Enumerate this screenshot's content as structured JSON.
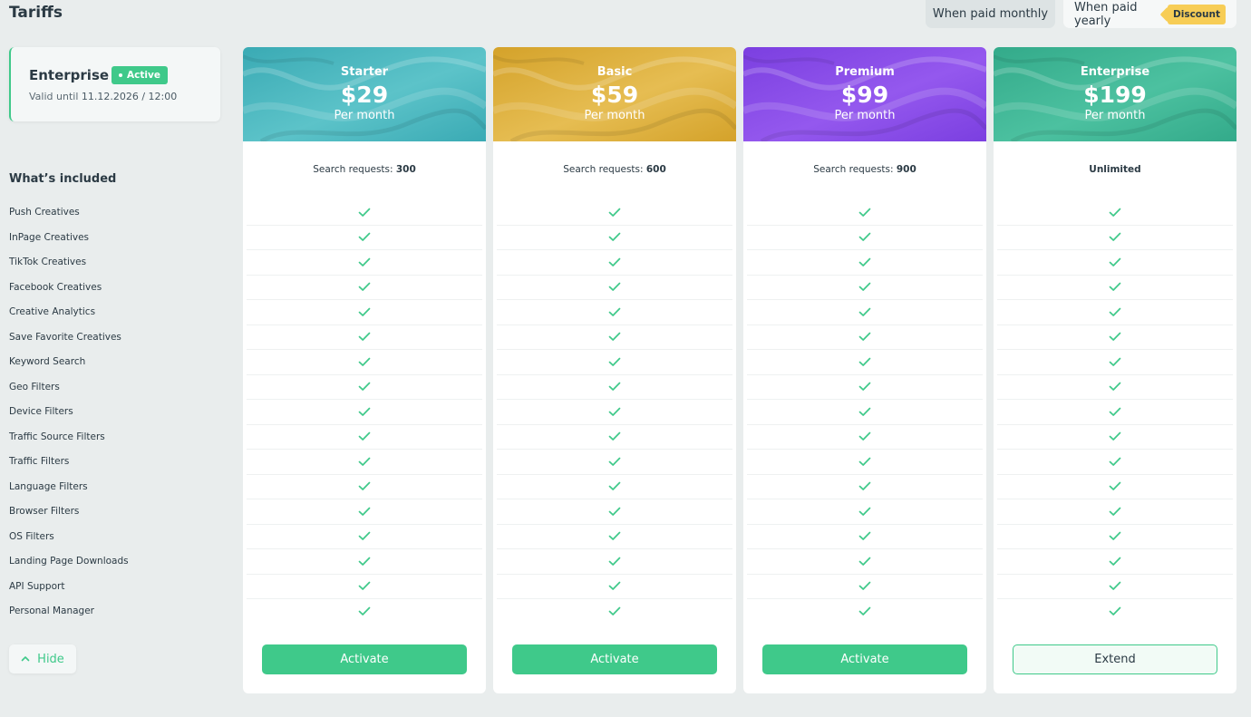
{
  "page_title": "Tariffs",
  "billing_toggle": {
    "monthly_label": "When paid monthly",
    "yearly_label": "When paid yearly",
    "discount_badge": "Discount"
  },
  "current_plan": {
    "name": "Enterprise",
    "status": "Active",
    "valid_until_label": "Valid until",
    "valid_until_value": "11.12.2026 / 12:00"
  },
  "included": {
    "title": "What’s included",
    "features": [
      "Push Creatives",
      "InPage Creatives",
      "TikTok Creatives",
      "Facebook Creatives",
      "Creative Analytics",
      "Save Favorite Creatives",
      "Keyword Search",
      "Geo Filters",
      "Device Filters",
      "Traffic Source Filters",
      "Traffic Filters",
      "Language Filters",
      "Browser Filters",
      "OS Filters",
      "Landing Page Downloads",
      "API Support",
      "Personal Manager"
    ]
  },
  "hide_label": "Hide",
  "plans": [
    {
      "name": "Starter",
      "price": "$29",
      "period": "Per month",
      "quota_label": "Search requests: ",
      "quota_value": "300",
      "button": "Activate",
      "button_style": "primary",
      "color": "#3aaab4",
      "color2": "#5cc3c9"
    },
    {
      "name": "Basic",
      "price": "$59",
      "period": "Per month",
      "quota_label": "Search requests: ",
      "quota_value": "600",
      "button": "Activate",
      "button_style": "primary",
      "color": "#d4a22a",
      "color2": "#e6bd52"
    },
    {
      "name": "Premium",
      "price": "$99",
      "period": "Per month",
      "quota_label": "Search requests: ",
      "quota_value": "900",
      "button": "Activate",
      "button_style": "primary",
      "color": "#7b3fe0",
      "color2": "#9458ee"
    },
    {
      "name": "Enterprise",
      "price": "$199",
      "period": "Per month",
      "quota_label": "",
      "quota_value": "Unlimited",
      "button": "Extend",
      "button_style": "outline",
      "color": "#33aa8a",
      "color2": "#4cc1a0"
    }
  ],
  "colors": {
    "accent": "#3fc98a",
    "background": "#e9eded",
    "discount": "#f7cd56"
  },
  "icons": {
    "check": "check-icon",
    "chevron": "chevron-up-icon"
  }
}
